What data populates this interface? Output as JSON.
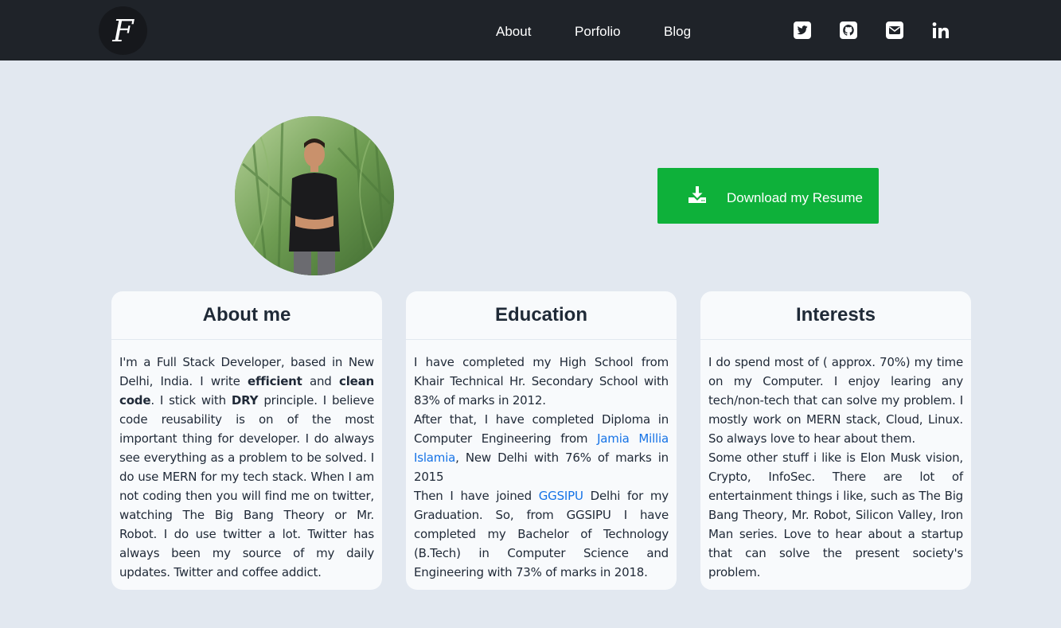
{
  "nav": {
    "logo_letter": "F",
    "links": [
      "About",
      "Porfolio",
      "Blog"
    ],
    "social_icons": [
      "twitter-icon",
      "github-icon",
      "mail-icon",
      "linkedin-icon"
    ]
  },
  "hero": {
    "download_label": "Download my Resume"
  },
  "colors": {
    "navbar": "#1f2329",
    "page_bg": "#e2e8f0",
    "card_bg": "#f8fafc",
    "button": "#0eb13a",
    "link": "#1673e6"
  },
  "about": {
    "title": "About me",
    "t1": "I'm a Full Stack Developer, based in New Delhi, India. I write ",
    "b1": "efficient",
    "t2": " and ",
    "b2": "clean code",
    "t3": ". I stick with ",
    "b3": "DRY",
    "t4": " principle. I believe code reusability is on of the most important thing for developer. I do always see everything as a problem to be solved. I do use MERN for my tech stack. When I am not coding then you will find me on twitter, watching The Big Bang Theory or Mr. Robot. I do use twitter a lot. Twitter has always been my source of my daily updates. Twitter and coffee addict."
  },
  "education": {
    "title": "Education",
    "p1": "I have completed my High School from Khair Technical Hr. Secondary School with 83% of marks in 2012.",
    "p2_pre": "After that, I have completed Diploma in Computer Engineering from ",
    "p2_link": "Jamia Millia Islamia",
    "p2_post": ", New Delhi with 76% of marks in 2015",
    "p3_pre": "Then I have joined ",
    "p3_link": "GGSIPU",
    "p3_post": " Delhi for my Graduation. So, from GGSIPU I have completed my Bachelor of Technology (B.Tech) in Computer Science and Engineering with 73% of marks in 2018."
  },
  "interests": {
    "title": "Interests",
    "p1": "I do spend most of ( approx. 70%) my time on my Computer. I enjoy learing any tech/non-tech that can solve my problem. I mostly work on MERN stack, Cloud, Linux. So always love to hear about them.",
    "p2": "Some other stuff i like is Elon Musk vision, Crypto, InfoSec. There are lot of entertainment things i like, such as The Big Bang Theory, Mr. Robot, Silicon Valley, Iron Man series. Love to hear about a startup that can solve the present society's problem."
  }
}
